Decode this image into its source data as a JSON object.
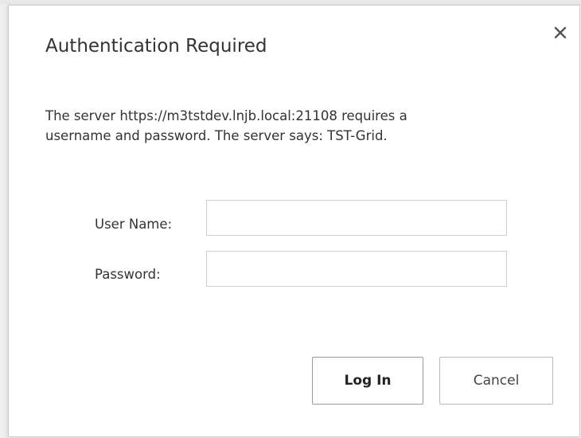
{
  "dialog": {
    "title": "Authentication Required",
    "close_icon": "close-icon",
    "message_line1": "The server https://m3tstdev.lnjb.local:21108 requires a",
    "message_line2": "username and password. The server says: TST-Grid.",
    "username_label": "User Name:",
    "username_value": "",
    "password_label": "Password:",
    "password_value": "",
    "login_label": "Log In",
    "cancel_label": "Cancel"
  }
}
